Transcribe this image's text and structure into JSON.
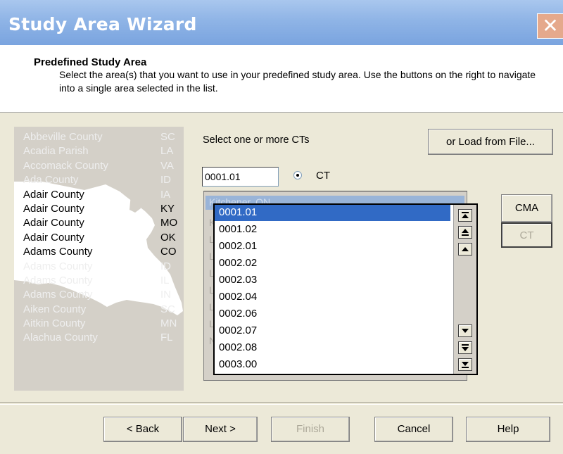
{
  "window": {
    "title": "Study Area Wizard",
    "close_glyph": "✕"
  },
  "header": {
    "title": "Predefined Study Area",
    "description": "Select the area(s) that you want to use in your predefined study area.  Use the buttons on the right to navigate into a single area selected in the list."
  },
  "state_list": [
    {
      "name": "Abbeville County",
      "state": "SC"
    },
    {
      "name": "Acadia Parish",
      "state": "LA"
    },
    {
      "name": "Accomack County",
      "state": "VA"
    },
    {
      "name": "Ada County",
      "state": "ID"
    },
    {
      "name": "Adair County",
      "state": "IA"
    },
    {
      "name": "Adair County",
      "state": "KY"
    },
    {
      "name": "Adair County",
      "state": "MO"
    },
    {
      "name": "Adair County",
      "state": "OK"
    },
    {
      "name": "Adams County",
      "state": "CO"
    },
    {
      "name": "Adams County",
      "state": "ID"
    },
    {
      "name": "Adams County",
      "state": "IL"
    },
    {
      "name": "Adams County",
      "state": "IN"
    },
    {
      "name": "Aiken County",
      "state": "SC"
    },
    {
      "name": "Aitkin County",
      "state": "MN"
    },
    {
      "name": "Alachua County",
      "state": "FL"
    }
  ],
  "selection": {
    "label": "Select one or more CTs",
    "load_button": "or Load from File...",
    "ct_input_value": "0001.01",
    "radio_label": "CT"
  },
  "level_buttons": {
    "cma": "CMA",
    "ct": "CT"
  },
  "cma_list": {
    "first_item": "Kitchener, ON"
  },
  "ct_list": {
    "selected_index": 0,
    "items": [
      "0001.01",
      "0002.01",
      "0002.02",
      "0002.03",
      "0002.04",
      "0002.06",
      "0002.07",
      "0002.08",
      "0003.00"
    ],
    "items_full": [
      "0001.01",
      "0001.02",
      "0002.01",
      "0002.02",
      "0002.03",
      "0002.04",
      "0002.06",
      "0002.07",
      "0002.08",
      "0003.00"
    ]
  },
  "footer": {
    "back": "< Back",
    "next": "Next >",
    "finish": "Finish",
    "cancel": "Cancel",
    "help": "Help"
  }
}
